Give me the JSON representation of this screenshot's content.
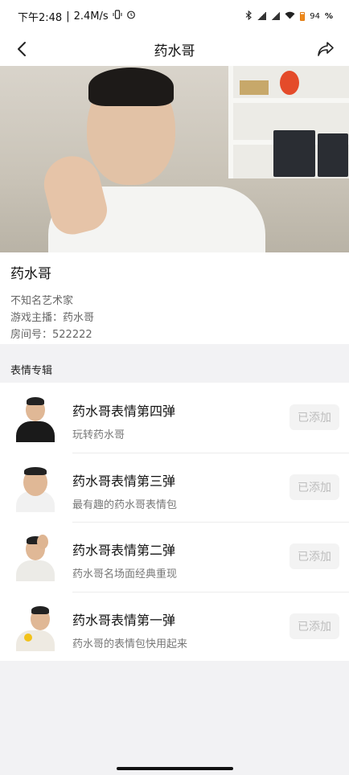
{
  "status_bar": {
    "time": "下午2:48",
    "network_speed": "2.4M/s",
    "battery": "94",
    "battery_unit": "%",
    "icons": [
      "vibrate-icon",
      "alarm-icon",
      "bluetooth-icon",
      "signal-icon",
      "wifi-icon",
      "battery-icon"
    ]
  },
  "nav": {
    "title": "药水哥",
    "back_icon": "chevron-left-icon",
    "share_icon": "share-icon"
  },
  "profile": {
    "name": "药水哥",
    "lines": [
      "不知名艺术家",
      "游戏主播：药水哥",
      "房间号：522222"
    ]
  },
  "section": {
    "title": "表情专辑"
  },
  "albums": [
    {
      "title": "药水哥表情第四弹",
      "subtitle": "玩转药水哥",
      "button": "已添加"
    },
    {
      "title": "药水哥表情第三弹",
      "subtitle": "最有趣的药水哥表情包",
      "button": "已添加"
    },
    {
      "title": "药水哥表情第二弹",
      "subtitle": "药水哥名场面经典重现",
      "button": "已添加"
    },
    {
      "title": "药水哥表情第一弹",
      "subtitle": "药水哥的表情包快用起来",
      "button": "已添加"
    }
  ],
  "colors": {
    "page_bg": "#f2f2f4",
    "card_bg": "#ffffff",
    "button_bg": "#f3f3f3",
    "button_text": "#bdbdbd",
    "battery": "#f08a1a"
  }
}
